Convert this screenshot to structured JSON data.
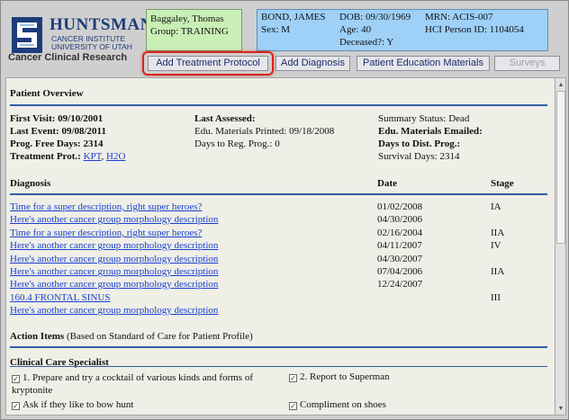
{
  "logo": {
    "name": "HUNTSMAN",
    "sub1": "CANCER INSTITUTE",
    "sub2": "UNIVERSITY OF UTAH",
    "app_title": "Cancer Clinical Research"
  },
  "user": {
    "name": "Baggaley, Thomas",
    "group": "Group: TRAINING"
  },
  "patient": {
    "name": "BOND, JAMES",
    "sex": "Sex: M",
    "dob": "DOB: 09/30/1969",
    "age": "Age: 40",
    "deceased": "Deceased?: Y",
    "mrn": "MRN: ACIS-007",
    "hci": "HCI Person ID: 1104054"
  },
  "tabs": [
    {
      "label": "Add Treatment Protocol"
    },
    {
      "label": "Add Diagnosis"
    },
    {
      "label": "Patient Education Materials"
    },
    {
      "label": "Surveys"
    }
  ],
  "overview": {
    "heading": "Patient Overview",
    "col1": {
      "first_visit": "First Visit: 09/10/2001",
      "last_event": "Last Event: 09/08/2011",
      "prog_free": "Prog. Free Days: 2314",
      "treatment_label": "Treatment Prot.:",
      "treatment_links": [
        "KPT",
        "H2O"
      ]
    },
    "col2": {
      "last_assessed": "Last Assessed:",
      "edu_printed": "Edu. Materials Printed: 09/18/2008",
      "days_reg": "Days to Reg. Prog.: 0"
    },
    "col3": {
      "summary_status": "Summary Status: Dead",
      "edu_emailed": "Edu. Materials Emailed:",
      "days_dist": "Days to Dist. Prog.:",
      "survival": "Survival Days: 2314"
    }
  },
  "diagnosis": {
    "headers": {
      "diagnosis": "Diagnosis",
      "date": "Date",
      "stage": "Stage"
    },
    "rows": [
      {
        "desc": "Time for a super description, right super heroes?",
        "date": "01/02/2008",
        "stage": "IA"
      },
      {
        "desc": "Here's another cancer group morphology description",
        "date": "04/30/2006",
        "stage": ""
      },
      {
        "desc": "Time for a super description, right super heroes?",
        "date": "02/16/2004",
        "stage": "IIA"
      },
      {
        "desc": "Here's another cancer group morphology description",
        "date": "04/11/2007",
        "stage": "IV"
      },
      {
        "desc": "Here's another cancer group morphology description",
        "date": "04/30/2007",
        "stage": ""
      },
      {
        "desc": "Here's another cancer group morphology description",
        "date": "07/04/2006",
        "stage": "IIA"
      },
      {
        "desc": "Here's another cancer group morphology description",
        "date": "12/24/2007",
        "stage": ""
      },
      {
        "desc": "160.4 FRONTAL SINUS",
        "date": "",
        "stage": "III"
      },
      {
        "desc": "Here's another cancer group morphology description",
        "date": "",
        "stage": ""
      }
    ]
  },
  "action_items": {
    "heading": "Action Items",
    "note": "(Based on Standard of Care for Patient Profile)",
    "specialist": "Clinical Care Specialist",
    "left": [
      "1. Prepare and try a cocktail of various kinds and forms of kryptonite",
      "Ask if they like to bow hunt"
    ],
    "right": [
      "2. Report to Superman",
      "Compliment on shoes"
    ]
  }
}
